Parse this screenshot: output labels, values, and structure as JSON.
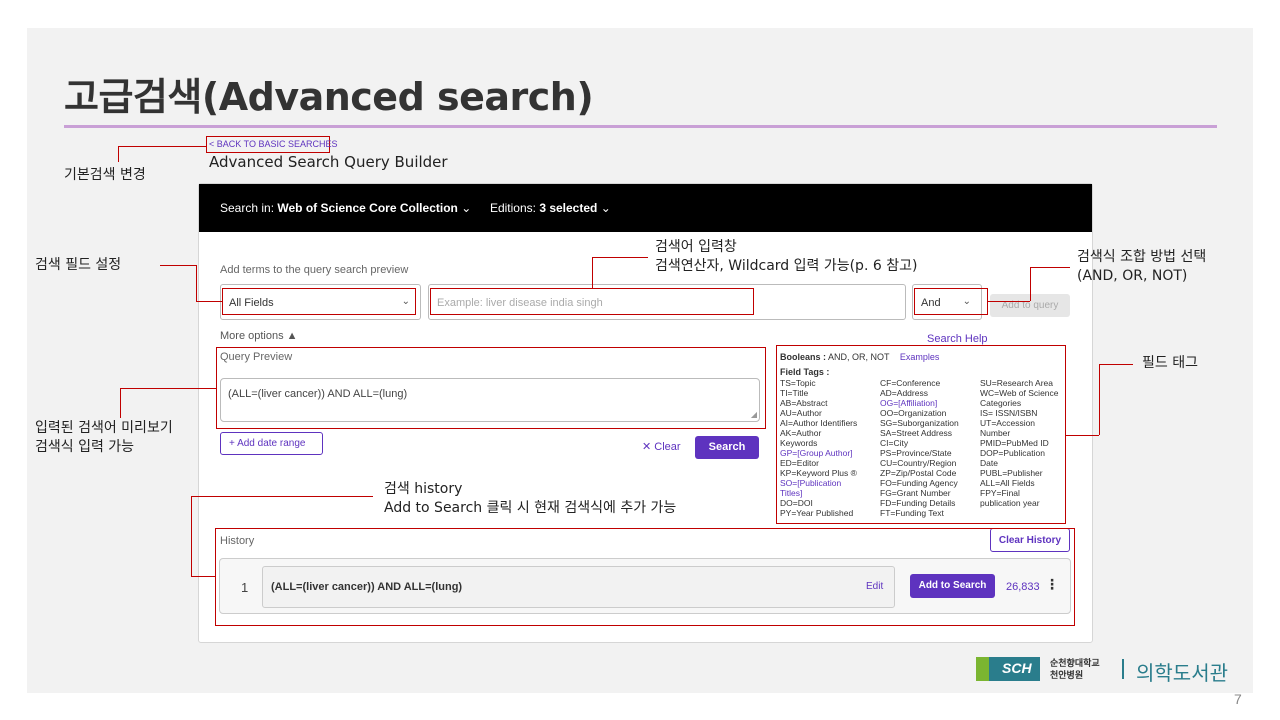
{
  "slide": {
    "title": "고급검색(Advanced  search)",
    "page_number": "7"
  },
  "builder": {
    "back_link": "< BACK TO BASIC SEARCHES",
    "heading": "Advanced Search Query Builder",
    "search_in_label": "Search in:",
    "search_in_value": "Web of Science Core Collection",
    "editions_label": "Editions:",
    "editions_value": "3 selected",
    "add_terms_label": "Add terms to the query search preview",
    "field_select_value": "All Fields",
    "term_placeholder": "Example: liver disease india singh",
    "boolean_value": "And",
    "add_to_query": "Add to query",
    "more_options": "More options",
    "search_help": "Search Help",
    "query_preview_label": "Query Preview",
    "query_preview_text": "(ALL=(liver cancer)) AND ALL=(lung)",
    "add_date_range": "+ Add date range",
    "clear": "Clear",
    "search": "Search"
  },
  "field_tags": {
    "booleans_label": "Booleans :",
    "booleans_value": "AND, OR, NOT",
    "examples": "Examples",
    "field_tags_label": "Field Tags :",
    "col1": [
      "TS=Topic",
      "TI=Title",
      "AB=Abstract",
      "AU=Author",
      "AI=Author Identifiers",
      "AK=Author",
      "Keywords",
      "GP=[Group Author]",
      "ED=Editor",
      "KP=Keyword Plus ®",
      "SO=[Publication",
      "Titles]",
      "DO=DOI",
      "PY=Year Published"
    ],
    "col2": [
      "CF=Conference",
      "AD=Address",
      "OG=[Affiliation]",
      "OO=Organization",
      "SG=Suborganization",
      "SA=Street Address",
      "CI=City",
      "PS=Province/State",
      "CU=Country/Region",
      "ZP=Zip/Postal Code",
      "FO=Funding Agency",
      "FG=Grant Number",
      "FD=Funding Details",
      "FT=Funding Text"
    ],
    "col3": [
      "SU=Research Area",
      "WC=Web of Science",
      "Categories",
      "IS= ISSN/ISBN",
      "UT=Accession",
      "Number",
      "PMID=PubMed ID",
      "DOP=Publication",
      "Date",
      "PUBL=Publisher",
      "ALL=All Fields",
      "FPY=Final",
      "publication year"
    ]
  },
  "history": {
    "label": "History",
    "clear_history": "Clear History",
    "rows": [
      {
        "num": "1",
        "query": "(ALL=(liver cancer)) AND ALL=(lung)",
        "edit": "Edit",
        "add_to_search": "Add to Search",
        "count": "26,833"
      }
    ]
  },
  "annotations": {
    "basic_change": "기본검색 변경",
    "field_setting": "검색 필드 설정",
    "input_title": "검색어 입력창",
    "input_desc": "검색연산자, Wildcard 입력 가능(p. 6 참고)",
    "combine_title": "검색식 조합 방법 선택",
    "combine_desc": "(AND, OR, NOT)",
    "field_tag": "필드 태그",
    "preview_title": "입력된 검색어 미리보기",
    "preview_desc": "검색식 입력 가능",
    "history_title": "검색 history",
    "history_desc": "Add to Search 클릭 시 현재 검색식에 추가 가능"
  },
  "logo": {
    "mark": "SCH",
    "org_line1": "순천향대학교",
    "org_line2": "천안병원",
    "library": "의학도서관"
  },
  "colors": {
    "accent": "#5e33bf",
    "annotation_red": "#c00000",
    "title_rule": "#c9a0d6"
  }
}
